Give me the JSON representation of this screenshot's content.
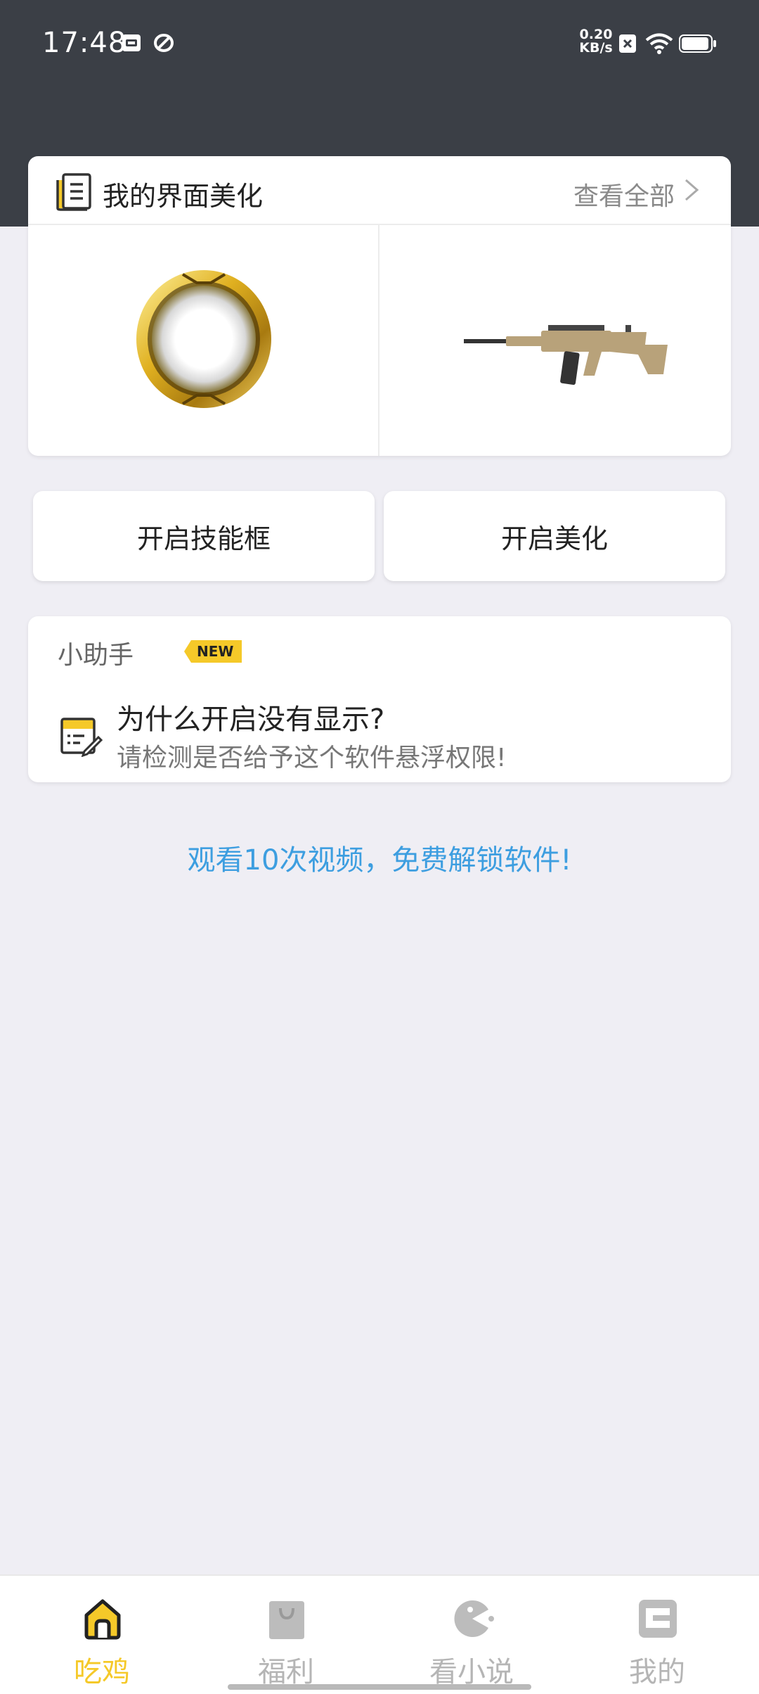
{
  "status_bar": {
    "time": "17:48",
    "net_speed_value": "0.20",
    "net_speed_unit": "KB/s",
    "battery_level": 0.95
  },
  "beautify": {
    "title": "我的界面美化",
    "view_all": "查看全部",
    "items": [
      {
        "icon": "golden-ring-frame"
      },
      {
        "icon": "rifle-skin"
      }
    ]
  },
  "actions": {
    "skill_frame": "开启技能框",
    "beautify": "开启美化"
  },
  "assistant": {
    "label": "小助手",
    "badge": "NEW",
    "question": "为什么开启没有显示?",
    "answer": "请检测是否给予这个软件悬浮权限!"
  },
  "unlock_text": "观看10次视频，免费解锁软件!",
  "nav": {
    "active_color": "#f5c929",
    "items": [
      {
        "label": "吃鸡",
        "icon": "home-icon",
        "active": true
      },
      {
        "label": "福利",
        "icon": "bag-icon",
        "active": false
      },
      {
        "label": "看小说",
        "icon": "pacman-icon",
        "active": false
      },
      {
        "label": "我的",
        "icon": "profile-icon",
        "active": false
      }
    ]
  }
}
